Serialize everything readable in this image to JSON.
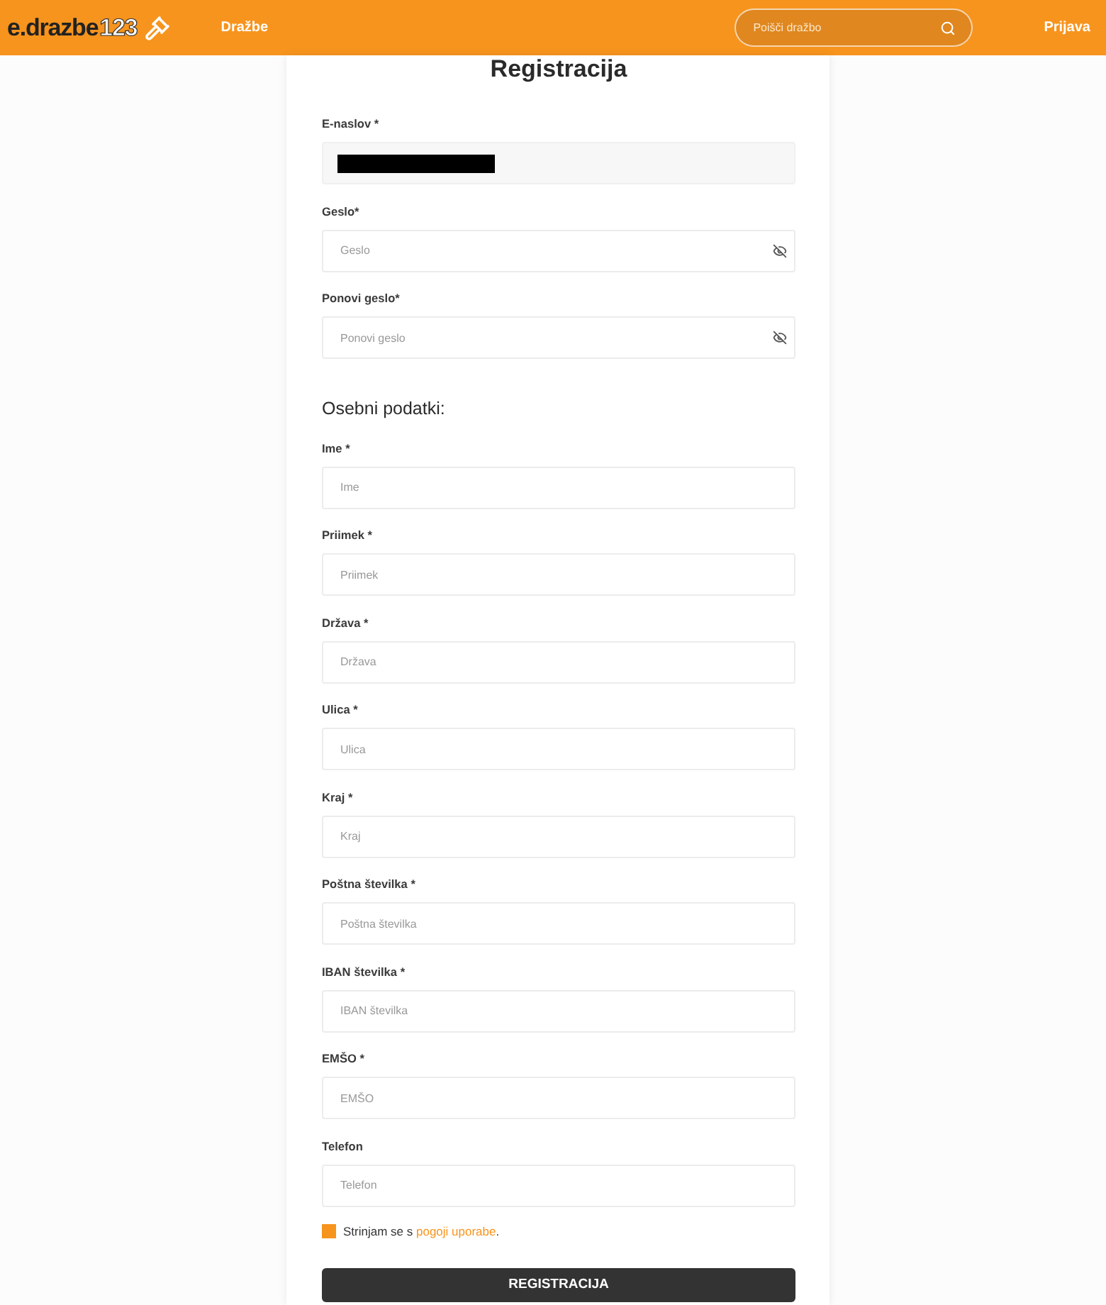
{
  "header": {
    "logo": {
      "text": "e.drazbe",
      "number": "123"
    },
    "nav": [
      {
        "label": "Dražbe"
      }
    ],
    "search": {
      "placeholder": "Poišči dražbo"
    },
    "login": "Prijava"
  },
  "form": {
    "title": "Registracija",
    "account_fields": [
      {
        "kind": "email",
        "label": "E-naslov *",
        "redacted": true
      },
      {
        "kind": "password",
        "label": "Geslo*",
        "placeholder": "Geslo"
      },
      {
        "kind": "password",
        "label": "Ponovi geslo*",
        "placeholder": "Ponovi geslo"
      }
    ],
    "section_title": "Osebni podatki:",
    "personal_fields": [
      {
        "kind": "text",
        "label": "Ime *",
        "placeholder": "Ime"
      },
      {
        "kind": "text",
        "label": "Priimek *",
        "placeholder": "Priimek"
      },
      {
        "kind": "text",
        "label": "Država *",
        "placeholder": "Država"
      },
      {
        "kind": "text",
        "label": "Ulica *",
        "placeholder": "Ulica"
      },
      {
        "kind": "text",
        "label": "Kraj *",
        "placeholder": "Kraj"
      },
      {
        "kind": "text",
        "label": "Poštna številka *",
        "placeholder": "Poštna številka"
      },
      {
        "kind": "text",
        "label": "IBAN številka *",
        "placeholder": "IBAN številka"
      },
      {
        "kind": "text",
        "label": "EMŠO *",
        "placeholder": "EMŠO"
      },
      {
        "kind": "text",
        "label": "Telefon",
        "placeholder": "Telefon"
      }
    ],
    "terms": {
      "checked": false,
      "text": "Strinjam se s",
      "link": "pogoji uporabe",
      "after": "."
    },
    "submit": "REGISTRACIJA"
  }
}
